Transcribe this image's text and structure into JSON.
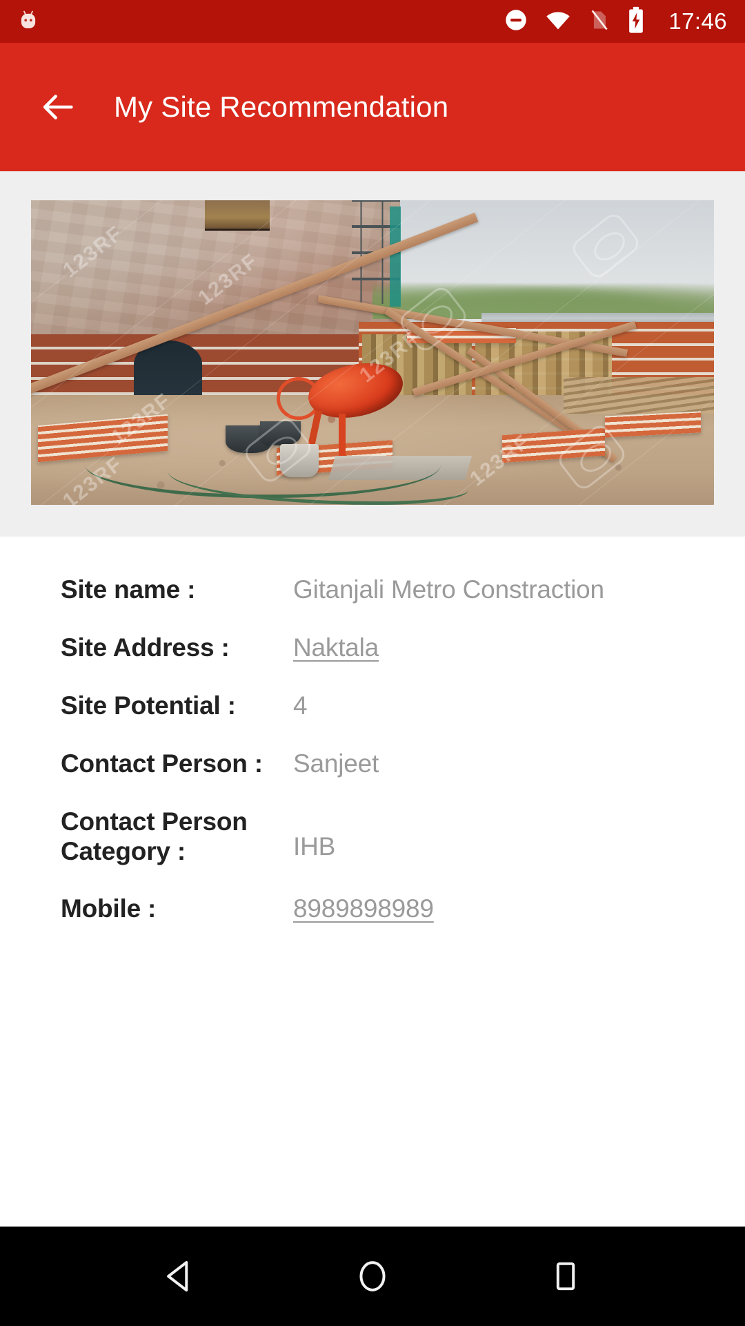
{
  "status_bar": {
    "time": "17:46",
    "icons": [
      {
        "name": "android-mascot-icon",
        "label": "Android mascot"
      },
      {
        "name": "do-not-disturb-icon",
        "label": "Do not disturb"
      },
      {
        "name": "wifi-icon",
        "label": "Wi-Fi connected"
      },
      {
        "name": "no-sim-card-icon",
        "label": "No SIM card"
      },
      {
        "name": "battery-charging-icon",
        "label": "Battery charging"
      }
    ]
  },
  "app_bar": {
    "title": "My Site Recommendation",
    "back_label": "Back"
  },
  "photo": {
    "alt": "Construction site with brick walls, timber formwork and an orange cement mixer",
    "watermark_text": "123RF"
  },
  "details": {
    "rows": [
      {
        "label": "Site name :",
        "value": "Gitanjali Metro Constraction",
        "link": false
      },
      {
        "label": "Site Address :",
        "value": "Naktala",
        "link": true
      },
      {
        "label": "Site Potential :",
        "value": "4",
        "link": false
      },
      {
        "label": "Contact Person :",
        "value": "Sanjeet",
        "link": false
      },
      {
        "label": "Contact Person Category :",
        "value": "IHB",
        "link": false
      },
      {
        "label": "Mobile :",
        "value": "8989898989",
        "link": true
      }
    ]
  },
  "nav_bar": {
    "back": "Back",
    "home": "Home",
    "recents": "Recent apps"
  },
  "colors": {
    "status_bar": "#b31309",
    "app_bar": "#d8291c",
    "banner_bg": "#efefef",
    "page_bg": "#ffffff",
    "label": "#222222",
    "value": "#9a9a9a",
    "nav_bar": "#000000"
  }
}
